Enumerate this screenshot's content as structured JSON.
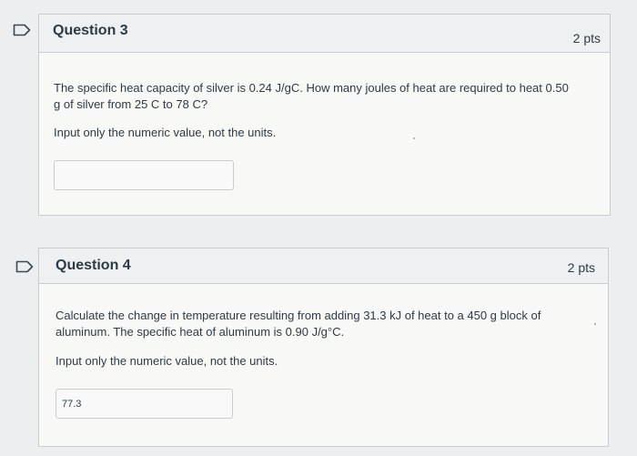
{
  "icons": {
    "flag_q3": "flag-icon",
    "flag_q4": "flag-icon"
  },
  "colors": {
    "flag_stroke": "#3a4a55",
    "panel_border": "#c7cdd1",
    "text": "#2d3b45"
  },
  "questions": [
    {
      "title": "Question 3",
      "points": "2 pts",
      "text_line1": "The specific heat capacity of silver is 0.24 J/gC.  How many joules of heat are required to heat 0.50",
      "text_line2": "g of silver from 25 C to 78 C?",
      "instruction": "Input only the numeric value, not the units.",
      "answer_value": ""
    },
    {
      "title": "Question 4",
      "points": "2 pts",
      "text_line1": "Calculate the change in temperature resulting from adding 31.3 kJ of heat to a 450 g block of",
      "text_line2": "aluminum.  The specific heat of aluminum is 0.90 J/g°C.",
      "instruction": "Input only the numeric value, not the units.",
      "answer_value": "77.3"
    }
  ]
}
